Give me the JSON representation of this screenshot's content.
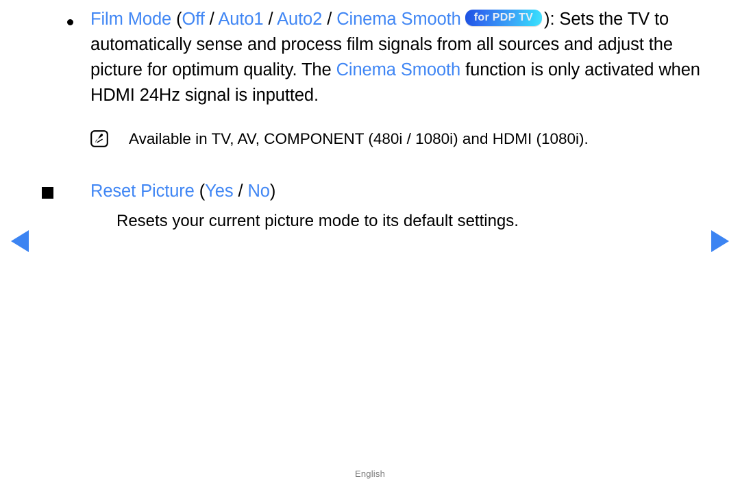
{
  "colors": {
    "accent_blue": "#4086f4",
    "text_black": "#000000",
    "footer_gray": "#7b7b7b",
    "badge_gradient_start": "#1b4fe0",
    "badge_gradient_end": "#46e0fd",
    "arrow_blue": "#3c84f2"
  },
  "film_mode": {
    "title": "Film Mode",
    "paren_open": "(",
    "option_off": "Off",
    "sep1": "/",
    "option_auto1": "Auto1",
    "sep2": "/",
    "option_auto2": "Auto2",
    "sep3": "/",
    "option_cinema_smooth": "Cinema Smooth",
    "badge": "for PDP TV",
    "paren_close": ")",
    "desc_part1": ": Sets the TV to automatically sense and process film signals from all sources and adjust the picture for optimum quality. The ",
    "desc_highlight": "Cinema Smooth",
    "desc_part2": " function is only activated when HDMI 24Hz signal is inputted."
  },
  "note": {
    "icon": "note-pen-icon",
    "text": "Available in TV, AV, COMPONENT (480i / 1080i) and HDMI (1080i)."
  },
  "reset_picture": {
    "title": "Reset Picture",
    "paren_open": "(",
    "option_yes": "Yes",
    "sep": "/",
    "option_no": "No",
    "paren_close": ")",
    "description": "Resets your current picture mode to its default settings."
  },
  "navigation": {
    "prev_label": "previous-page",
    "next_label": "next-page"
  },
  "footer": {
    "language": "English"
  }
}
